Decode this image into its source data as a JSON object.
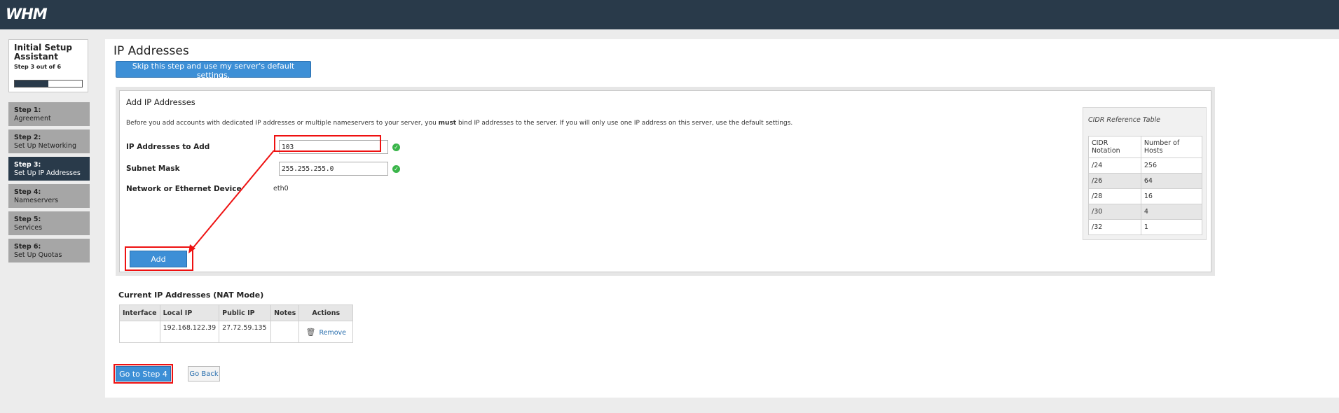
{
  "app": {
    "logo": "WHM"
  },
  "sidebar": {
    "wizard_title": "Initial Setup Assistant",
    "step_status": "Step 3 out of 6",
    "progress_fraction": 0.5,
    "steps": [
      {
        "num": "Step 1:",
        "label": "Agreement"
      },
      {
        "num": "Step 2:",
        "label": "Set Up Networking"
      },
      {
        "num": "Step 3:",
        "label": "Set Up IP Addresses",
        "active": true
      },
      {
        "num": "Step 4:",
        "label": "Nameservers"
      },
      {
        "num": "Step 5:",
        "label": "Services"
      },
      {
        "num": "Step 6:",
        "label": "Set Up Quotas"
      }
    ]
  },
  "main": {
    "title": "IP Addresses",
    "skip_label": "Skip this step and use my server's default settings.",
    "add_panel": {
      "title": "Add IP Addresses",
      "desc_before": "Before you add accounts with dedicated IP addresses or multiple nameservers to your server, you ",
      "desc_bold": "must",
      "desc_after": " bind IP addresses to the server. If you will only use one IP address on this server, use the default settings.",
      "ip_label": "IP Addresses to Add",
      "ip_value": "103",
      "subnet_label": "Subnet Mask",
      "subnet_value": "255.255.255.0",
      "device_label": "Network or Ethernet Device",
      "device_value": "eth0",
      "add_label": "Add"
    },
    "cidr": {
      "title": "CIDR Reference Table",
      "headers": [
        "CIDR Notation",
        "Number of Hosts"
      ],
      "rows": [
        [
          "/24",
          "256"
        ],
        [
          "/26",
          "64"
        ],
        [
          "/28",
          "16"
        ],
        [
          "/30",
          "4"
        ],
        [
          "/32",
          "1"
        ]
      ]
    },
    "current": {
      "title": "Current IP Addresses (NAT Mode)",
      "headers": [
        "Interface",
        "Local IP",
        "Public IP",
        "Notes",
        "Actions"
      ],
      "row": {
        "interface": "",
        "local_ip": "192.168.122.39",
        "public_ip": "27.72.59.135",
        "notes": "",
        "action": "Remove"
      }
    },
    "goto_label": "Go to Step 4",
    "goback_label": "Go Back"
  }
}
